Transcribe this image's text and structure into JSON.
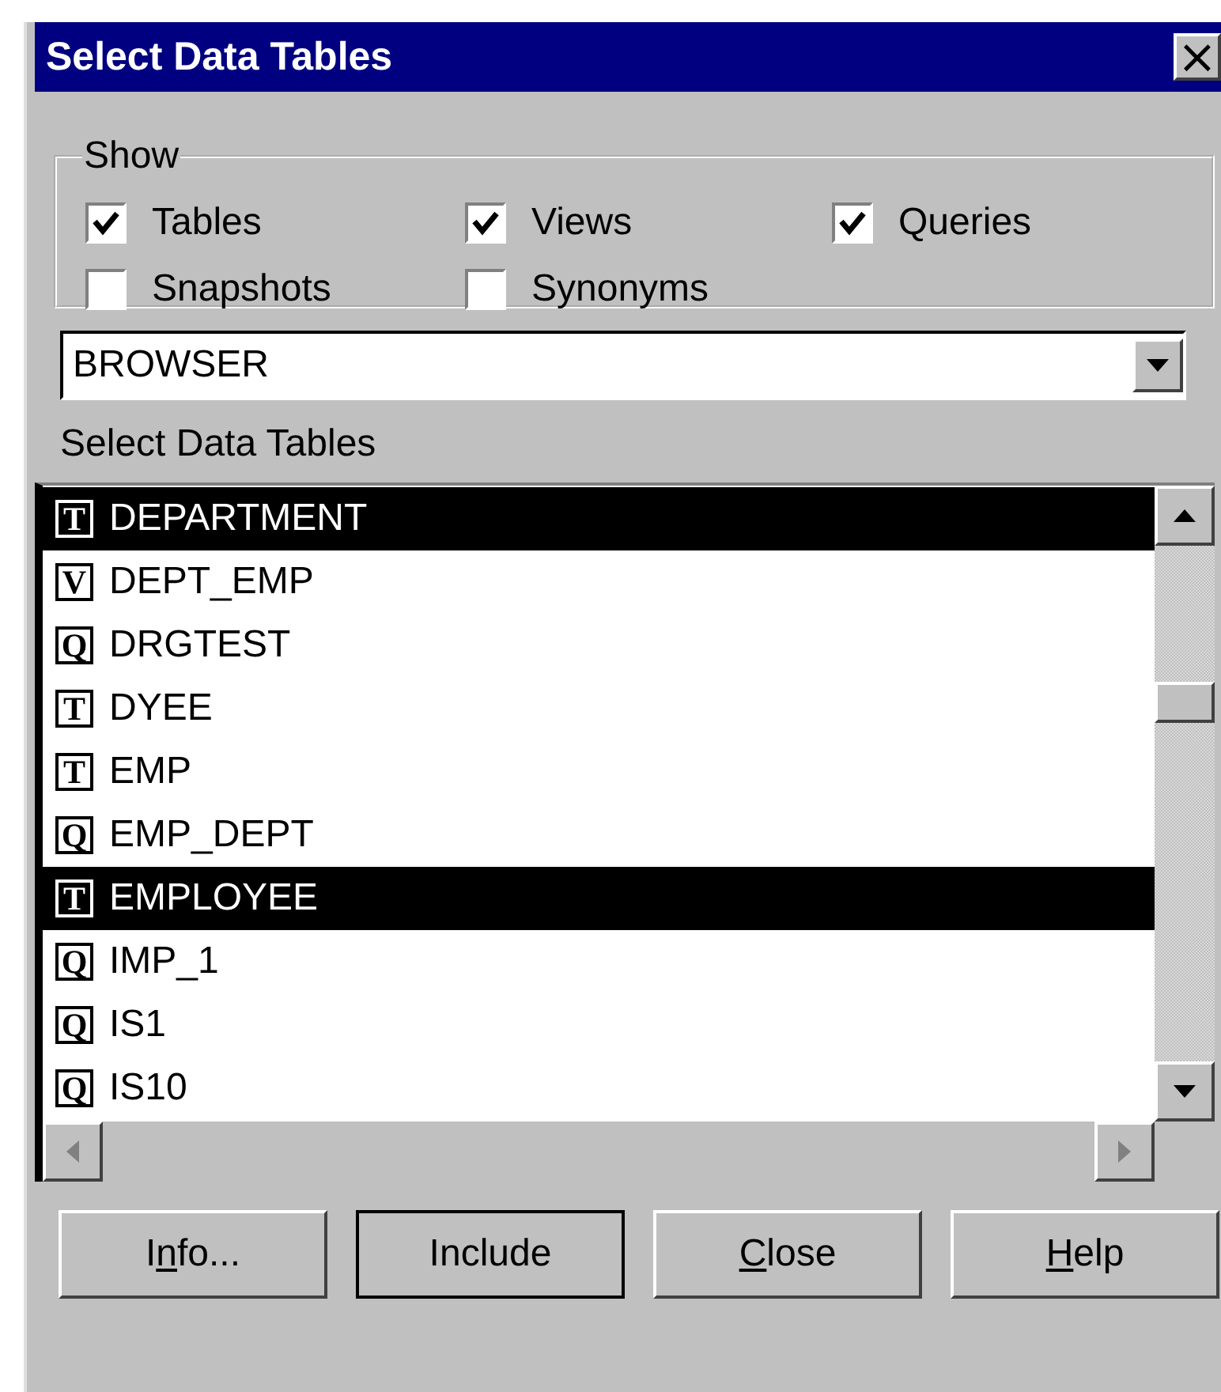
{
  "window": {
    "title": "Select Data Tables",
    "close_glyph": "×"
  },
  "show_group": {
    "title": "Show",
    "options": [
      {
        "label": "Tables",
        "checked": true
      },
      {
        "label": "Views",
        "checked": true
      },
      {
        "label": "Queries",
        "checked": true
      },
      {
        "label": "Snapshots",
        "checked": false
      },
      {
        "label": "Synonyms",
        "checked": false
      }
    ]
  },
  "owner_combo": {
    "value": "BROWSER"
  },
  "list_label": "Select Data Tables",
  "tables": [
    {
      "type_mark": "T",
      "name": "DEPARTMENT",
      "selected": true
    },
    {
      "type_mark": "V",
      "name": "DEPT_EMP",
      "selected": false
    },
    {
      "type_mark": "Q",
      "name": "DRGTEST",
      "selected": false
    },
    {
      "type_mark": "T",
      "name": "DYEE",
      "selected": false
    },
    {
      "type_mark": "T",
      "name": "EMP",
      "selected": false
    },
    {
      "type_mark": "Q",
      "name": "EMP_DEPT",
      "selected": false
    },
    {
      "type_mark": "T",
      "name": "EMPLOYEE",
      "selected": true
    },
    {
      "type_mark": "Q",
      "name": "IMP_1",
      "selected": false
    },
    {
      "type_mark": "Q",
      "name": "IS1",
      "selected": false
    },
    {
      "type_mark": "Q",
      "name": "IS10",
      "selected": false
    }
  ],
  "buttons": [
    {
      "before": "I",
      "accel": "n",
      "after": "fo...",
      "default": false
    },
    {
      "before": "Include",
      "default": true
    },
    {
      "accel": "C",
      "after": "lose",
      "default": false
    },
    {
      "accel": "H",
      "after": "elp",
      "default": false
    }
  ]
}
